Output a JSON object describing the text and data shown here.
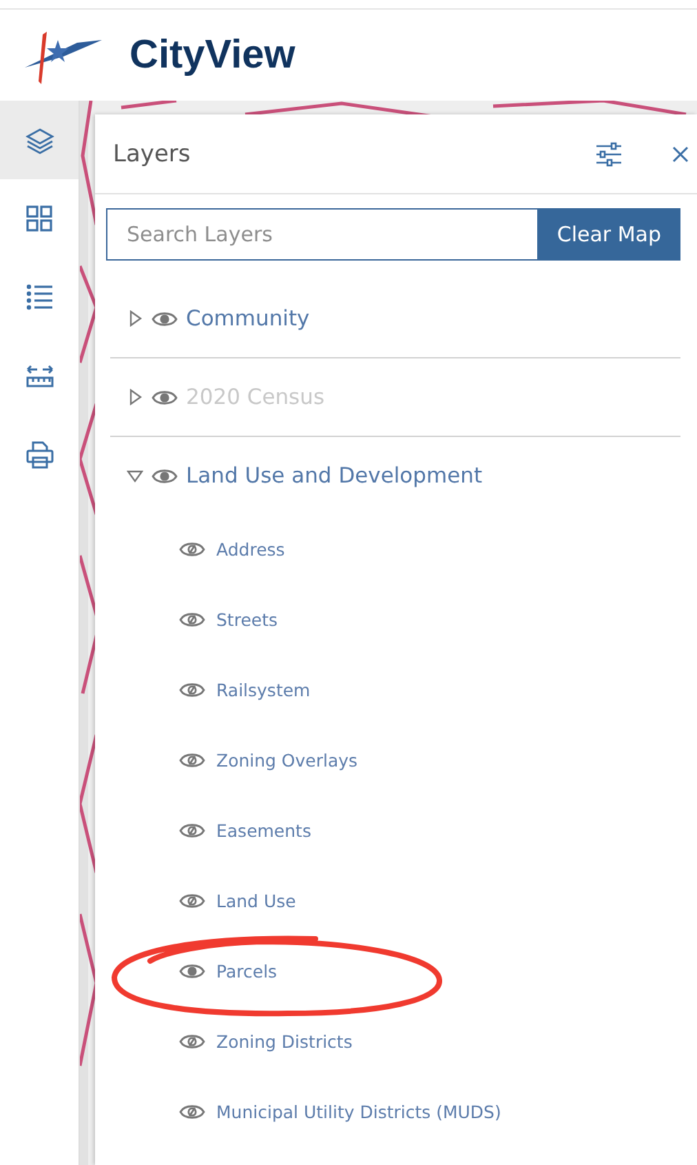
{
  "header": {
    "title": "CityView"
  },
  "sidebar": {
    "items": [
      {
        "kind": "layers",
        "selected": true
      },
      {
        "kind": "grid",
        "selected": false
      },
      {
        "kind": "list",
        "selected": false
      },
      {
        "kind": "measure",
        "selected": false
      },
      {
        "kind": "print",
        "selected": false
      }
    ]
  },
  "panel": {
    "title": "Layers",
    "search": {
      "placeholder": "Search Layers"
    },
    "clear_button": "Clear Map",
    "groups": [
      {
        "label": "Community",
        "expanded": false,
        "disabled": false,
        "visible": true
      },
      {
        "label": "2020 Census",
        "expanded": false,
        "disabled": true,
        "visible": true
      },
      {
        "label": "Land Use and Development",
        "expanded": true,
        "disabled": false,
        "visible": true,
        "children": [
          {
            "label": "Address",
            "visible": false,
            "highlighted": false
          },
          {
            "label": "Streets",
            "visible": false,
            "highlighted": false
          },
          {
            "label": "Railsystem",
            "visible": false,
            "highlighted": false
          },
          {
            "label": "Zoning Overlays",
            "visible": false,
            "highlighted": false
          },
          {
            "label": "Easements",
            "visible": false,
            "highlighted": false
          },
          {
            "label": "Land Use",
            "visible": false,
            "highlighted": false
          },
          {
            "label": "Parcels",
            "visible": true,
            "highlighted": true
          },
          {
            "label": "Zoning Districts",
            "visible": false,
            "highlighted": false
          },
          {
            "label": "Municipal Utility Districts (MUDS)",
            "visible": false,
            "highlighted": false
          }
        ]
      }
    ]
  }
}
